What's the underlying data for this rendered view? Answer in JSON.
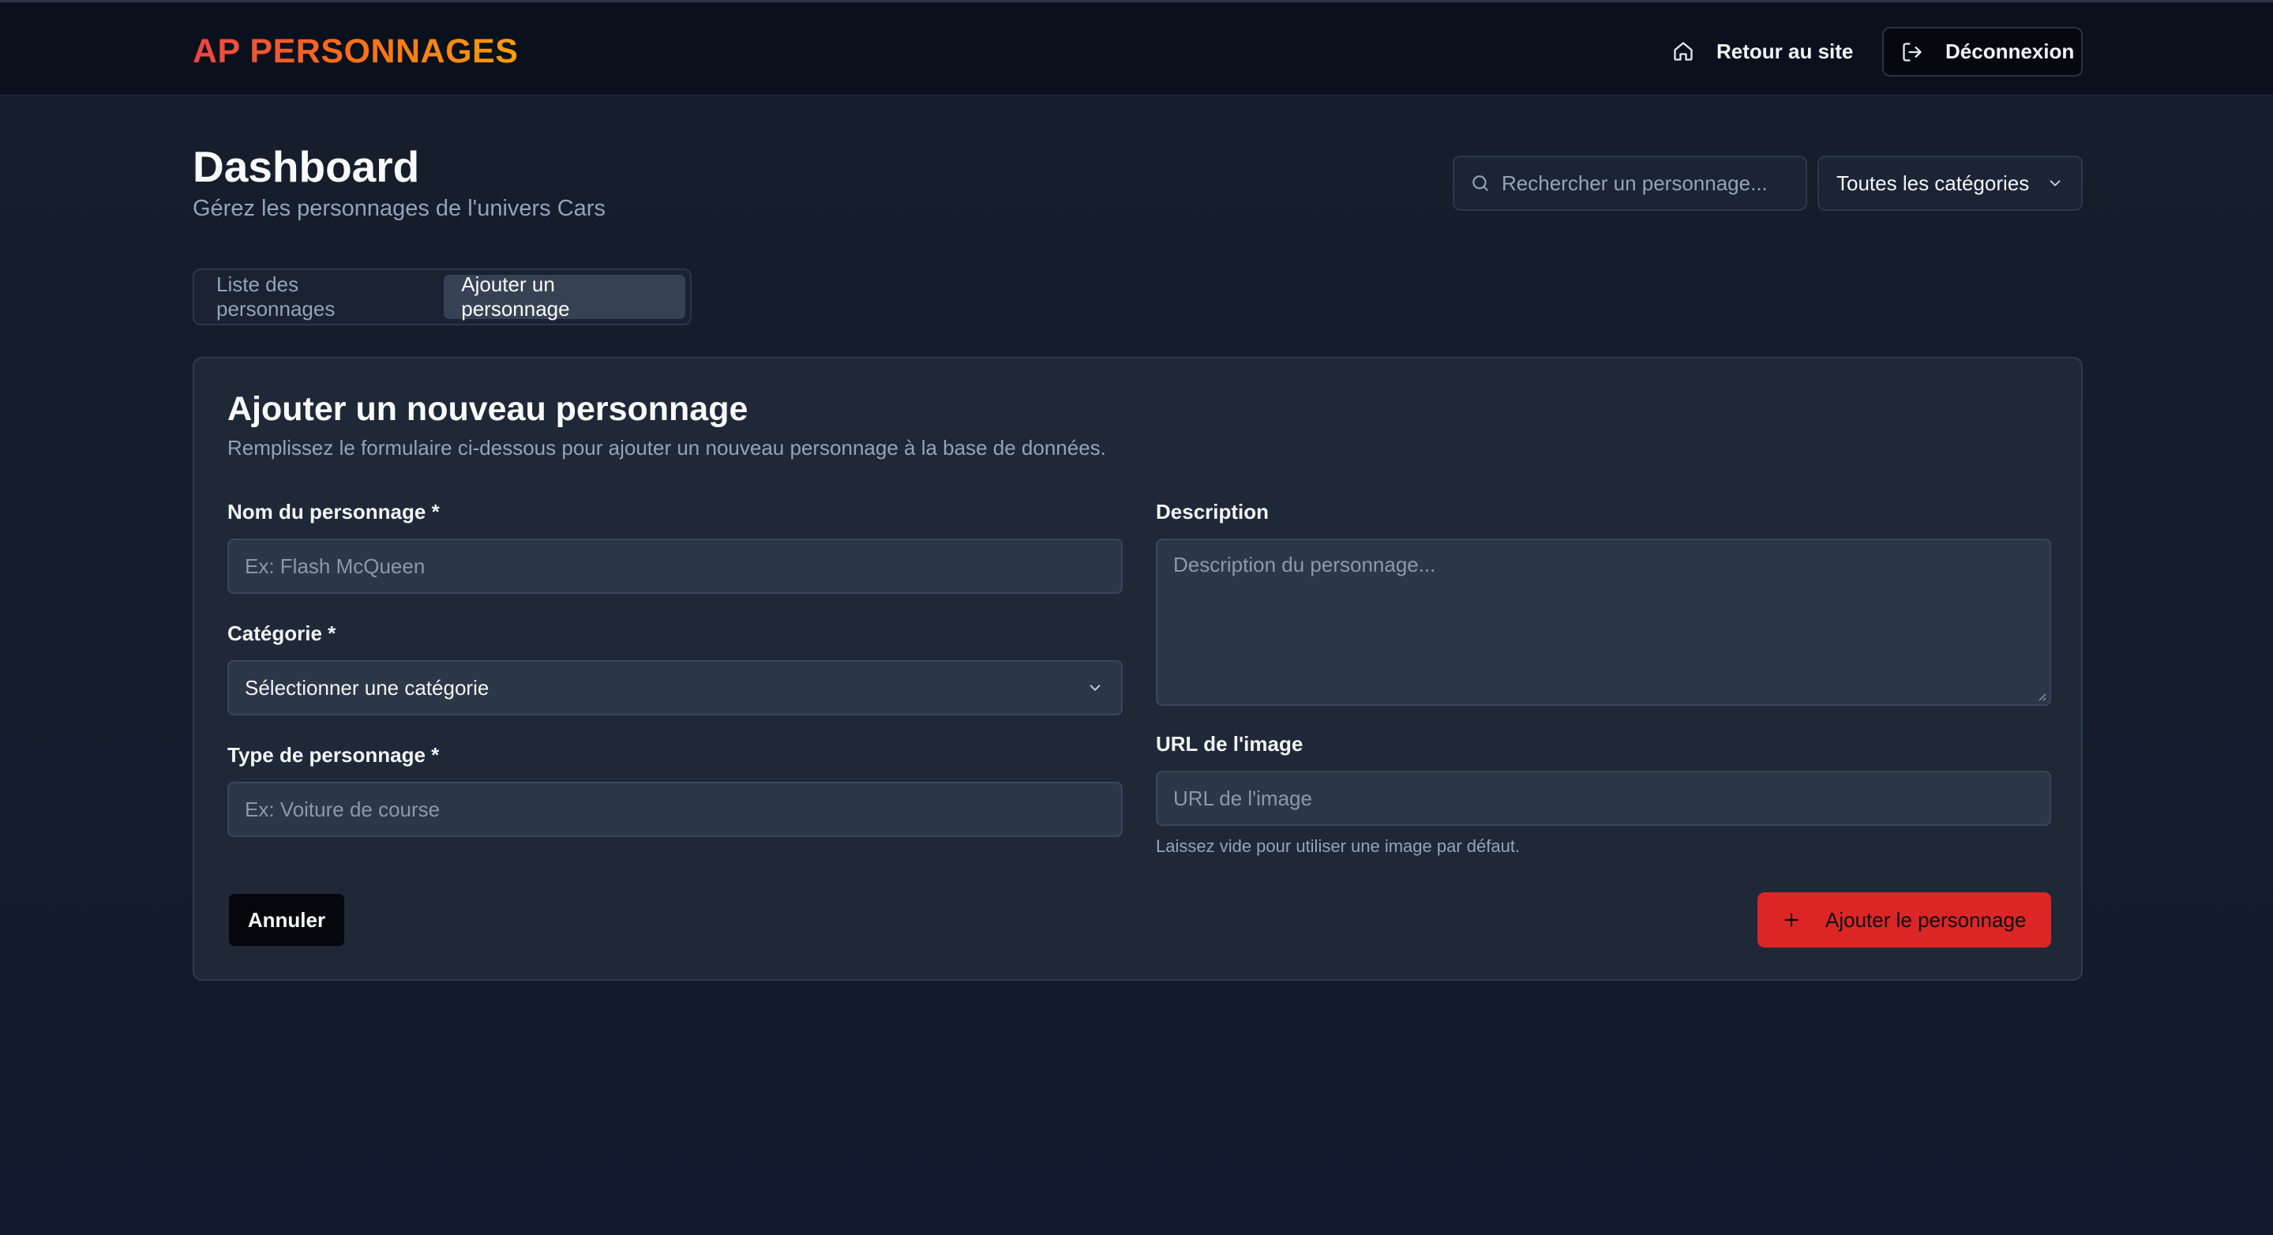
{
  "header": {
    "logo": "AP PERSONNAGES",
    "back_to_site_label": "Retour au site",
    "logout_label": "Déconnexion"
  },
  "dashboard": {
    "title": "Dashboard",
    "subtitle": "Gérez les personnages de l'univers Cars",
    "search_placeholder": "Rechercher un personnage...",
    "category_filter_value": "Toutes les catégories"
  },
  "tabs": [
    {
      "label": "Liste des personnages",
      "active": false
    },
    {
      "label": "Ajouter un personnage",
      "active": true
    }
  ],
  "form": {
    "title": "Ajouter un nouveau personnage",
    "description": "Remplissez le formulaire ci-dessous pour ajouter un nouveau personnage à la base de données.",
    "name_label": "Nom du personnage *",
    "name_placeholder": "Ex: Flash McQueen",
    "category_label": "Catégorie *",
    "category_value": "Sélectionner une catégorie",
    "type_label": "Type de personnage *",
    "type_placeholder": "Ex: Voiture de course",
    "description_label": "Description",
    "description_placeholder": "Description du personnage...",
    "image_url_label": "URL de l'image",
    "image_url_placeholder": "URL de l'image",
    "image_url_hint": "Laissez vide pour utiliser une image par défaut.",
    "cancel_label": "Annuler",
    "submit_label": "Ajouter le personnage"
  },
  "colors": {
    "accent_red": "#dc2626",
    "logo_gradient_start": "#ef4444",
    "logo_gradient_end": "#f59e0b"
  },
  "icons": [
    "home-icon",
    "logout-icon",
    "search-icon",
    "chevron-down-icon",
    "plus-icon"
  ]
}
